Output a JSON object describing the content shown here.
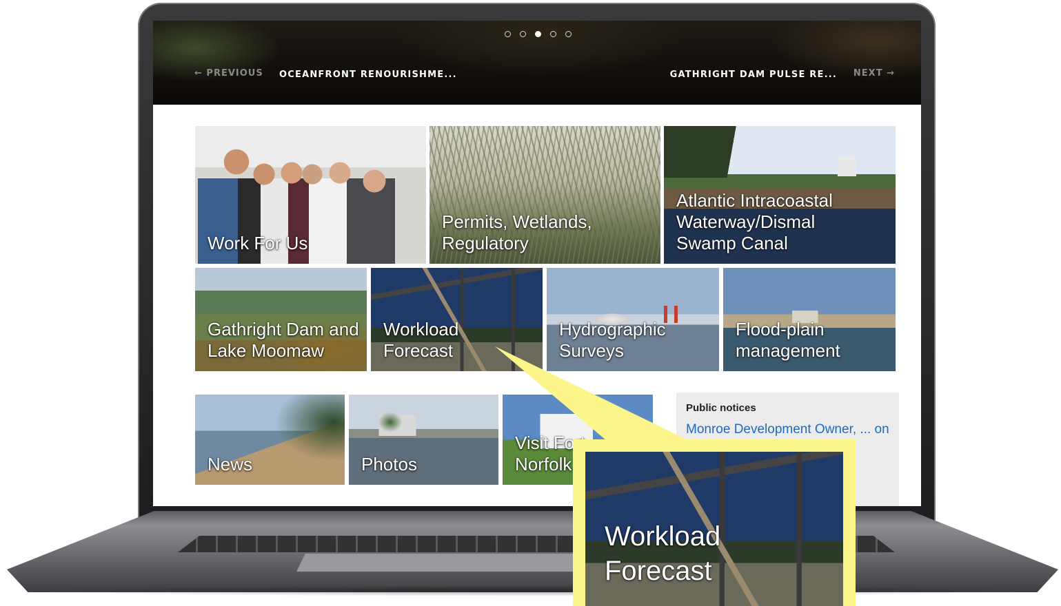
{
  "hero": {
    "carousel_dots": [
      false,
      false,
      true,
      false,
      false
    ],
    "previous_label": "← PREVIOUS",
    "previous_title": "OCEANFRONT RENOURISHME...",
    "next_title": "GATHRIGHT DAM PULSE RE...",
    "next_label": "NEXT →"
  },
  "tiles_row1": [
    {
      "label": "Work For Us"
    },
    {
      "label": "Permits, Wetlands, Regulatory"
    },
    {
      "label": "Atlantic Intracoastal Waterway/Dismal Swamp Canal"
    }
  ],
  "tiles_row2": [
    {
      "label": "Gathright Dam and Lake Moomaw"
    },
    {
      "label": "Workload Forecast"
    },
    {
      "label": "Hydrographic Surveys"
    },
    {
      "label": "Flood-plain management"
    }
  ],
  "tiles_row3": [
    {
      "label": "News"
    },
    {
      "label": "Photos"
    },
    {
      "label": "Visit Fort Norfolk"
    }
  ],
  "public_notices": {
    "title": "Public notices",
    "link_text": "Monroe Development Owner, ... on to"
  },
  "callout": {
    "label": "Workload Forecast",
    "color": "#fbf58a"
  }
}
